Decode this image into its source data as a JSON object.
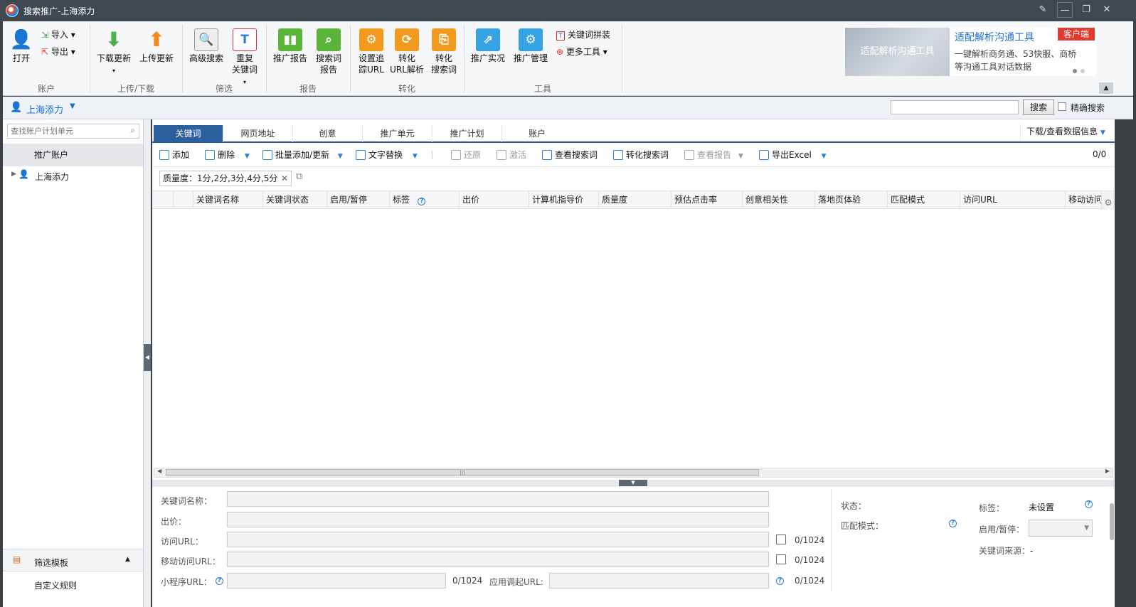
{
  "window": {
    "title": "搜索推广-上海添力"
  },
  "ribbon": {
    "account": {
      "open": "打开",
      "import": "导入",
      "export": "导出",
      "group": "账户"
    },
    "upload": {
      "download": "下载更新",
      "upload": "上传更新",
      "group": "上传/下载"
    },
    "filter": {
      "advanced_search": "高级搜索",
      "dup1": "重复",
      "dup2": "关键词",
      "group": "筛选"
    },
    "report": {
      "promo_report": "推广报告",
      "search_report1": "搜索词",
      "search_report2": "报告",
      "group": "报告"
    },
    "convert": {
      "track1": "设置追",
      "track2": "踪URL",
      "url1": "转化",
      "url2": "URL解析",
      "sw1": "转化",
      "sw2": "搜索词",
      "group": "转化"
    },
    "tools": {
      "live": "推广实况",
      "manage": "推广管理",
      "kw_combo": "关键词拼装",
      "more": "更多工具",
      "group": "工具"
    }
  },
  "promo": {
    "img_text": "适配解析沟通工具",
    "title": "适配解析沟通工具",
    "badge": "客户端",
    "line1": "一键解析商务通、53快服、商桥",
    "line2": "等沟通工具对话数据"
  },
  "account_bar": {
    "name": "上海添力",
    "search_btn": "搜索",
    "exact": "精确搜索"
  },
  "left": {
    "search_placeholder": "查找账户计划单元",
    "root": "推广账户",
    "account": "上海添力",
    "filter_template": "筛选模板",
    "custom_rule": "自定义规则"
  },
  "tabs": [
    "关键词",
    "网页地址",
    "创意",
    "推广单元",
    "推广计划",
    "账户"
  ],
  "download_info": "下载/查看数据信息",
  "toolbar": {
    "add": "添加",
    "delete": "删除",
    "batch": "批量添加/更新",
    "replace": "文字替换",
    "restore": "还原",
    "activate": "激活",
    "view_search": "查看搜索词",
    "convert_search": "转化搜索词",
    "view_report": "查看报告",
    "export": "导出Excel",
    "count": "0/0"
  },
  "filter_tag": "质量度：1分,2分,3分,4分,5分",
  "columns": [
    "关键词名称",
    "关键词状态",
    "启用/暂停",
    "标签",
    "出价",
    "计算机指导价",
    "质量度",
    "预估点击率",
    "创意相关性",
    "落地页体验",
    "匹配模式",
    "访问URL",
    "移动访问"
  ],
  "form": {
    "kw_name": "关键词名称：",
    "bid": "出价：",
    "url": "访问URL：",
    "murl": "移动访问URL：",
    "mini": "小程序URL：",
    "app": "应用调起URL:",
    "count": "0/1024",
    "status": "状态：",
    "match": "匹配模式：",
    "tag": "标签：",
    "tag_val": "未设置",
    "enable": "启用/暂停：",
    "source": "关键词来源：",
    "source_val": "-"
  }
}
